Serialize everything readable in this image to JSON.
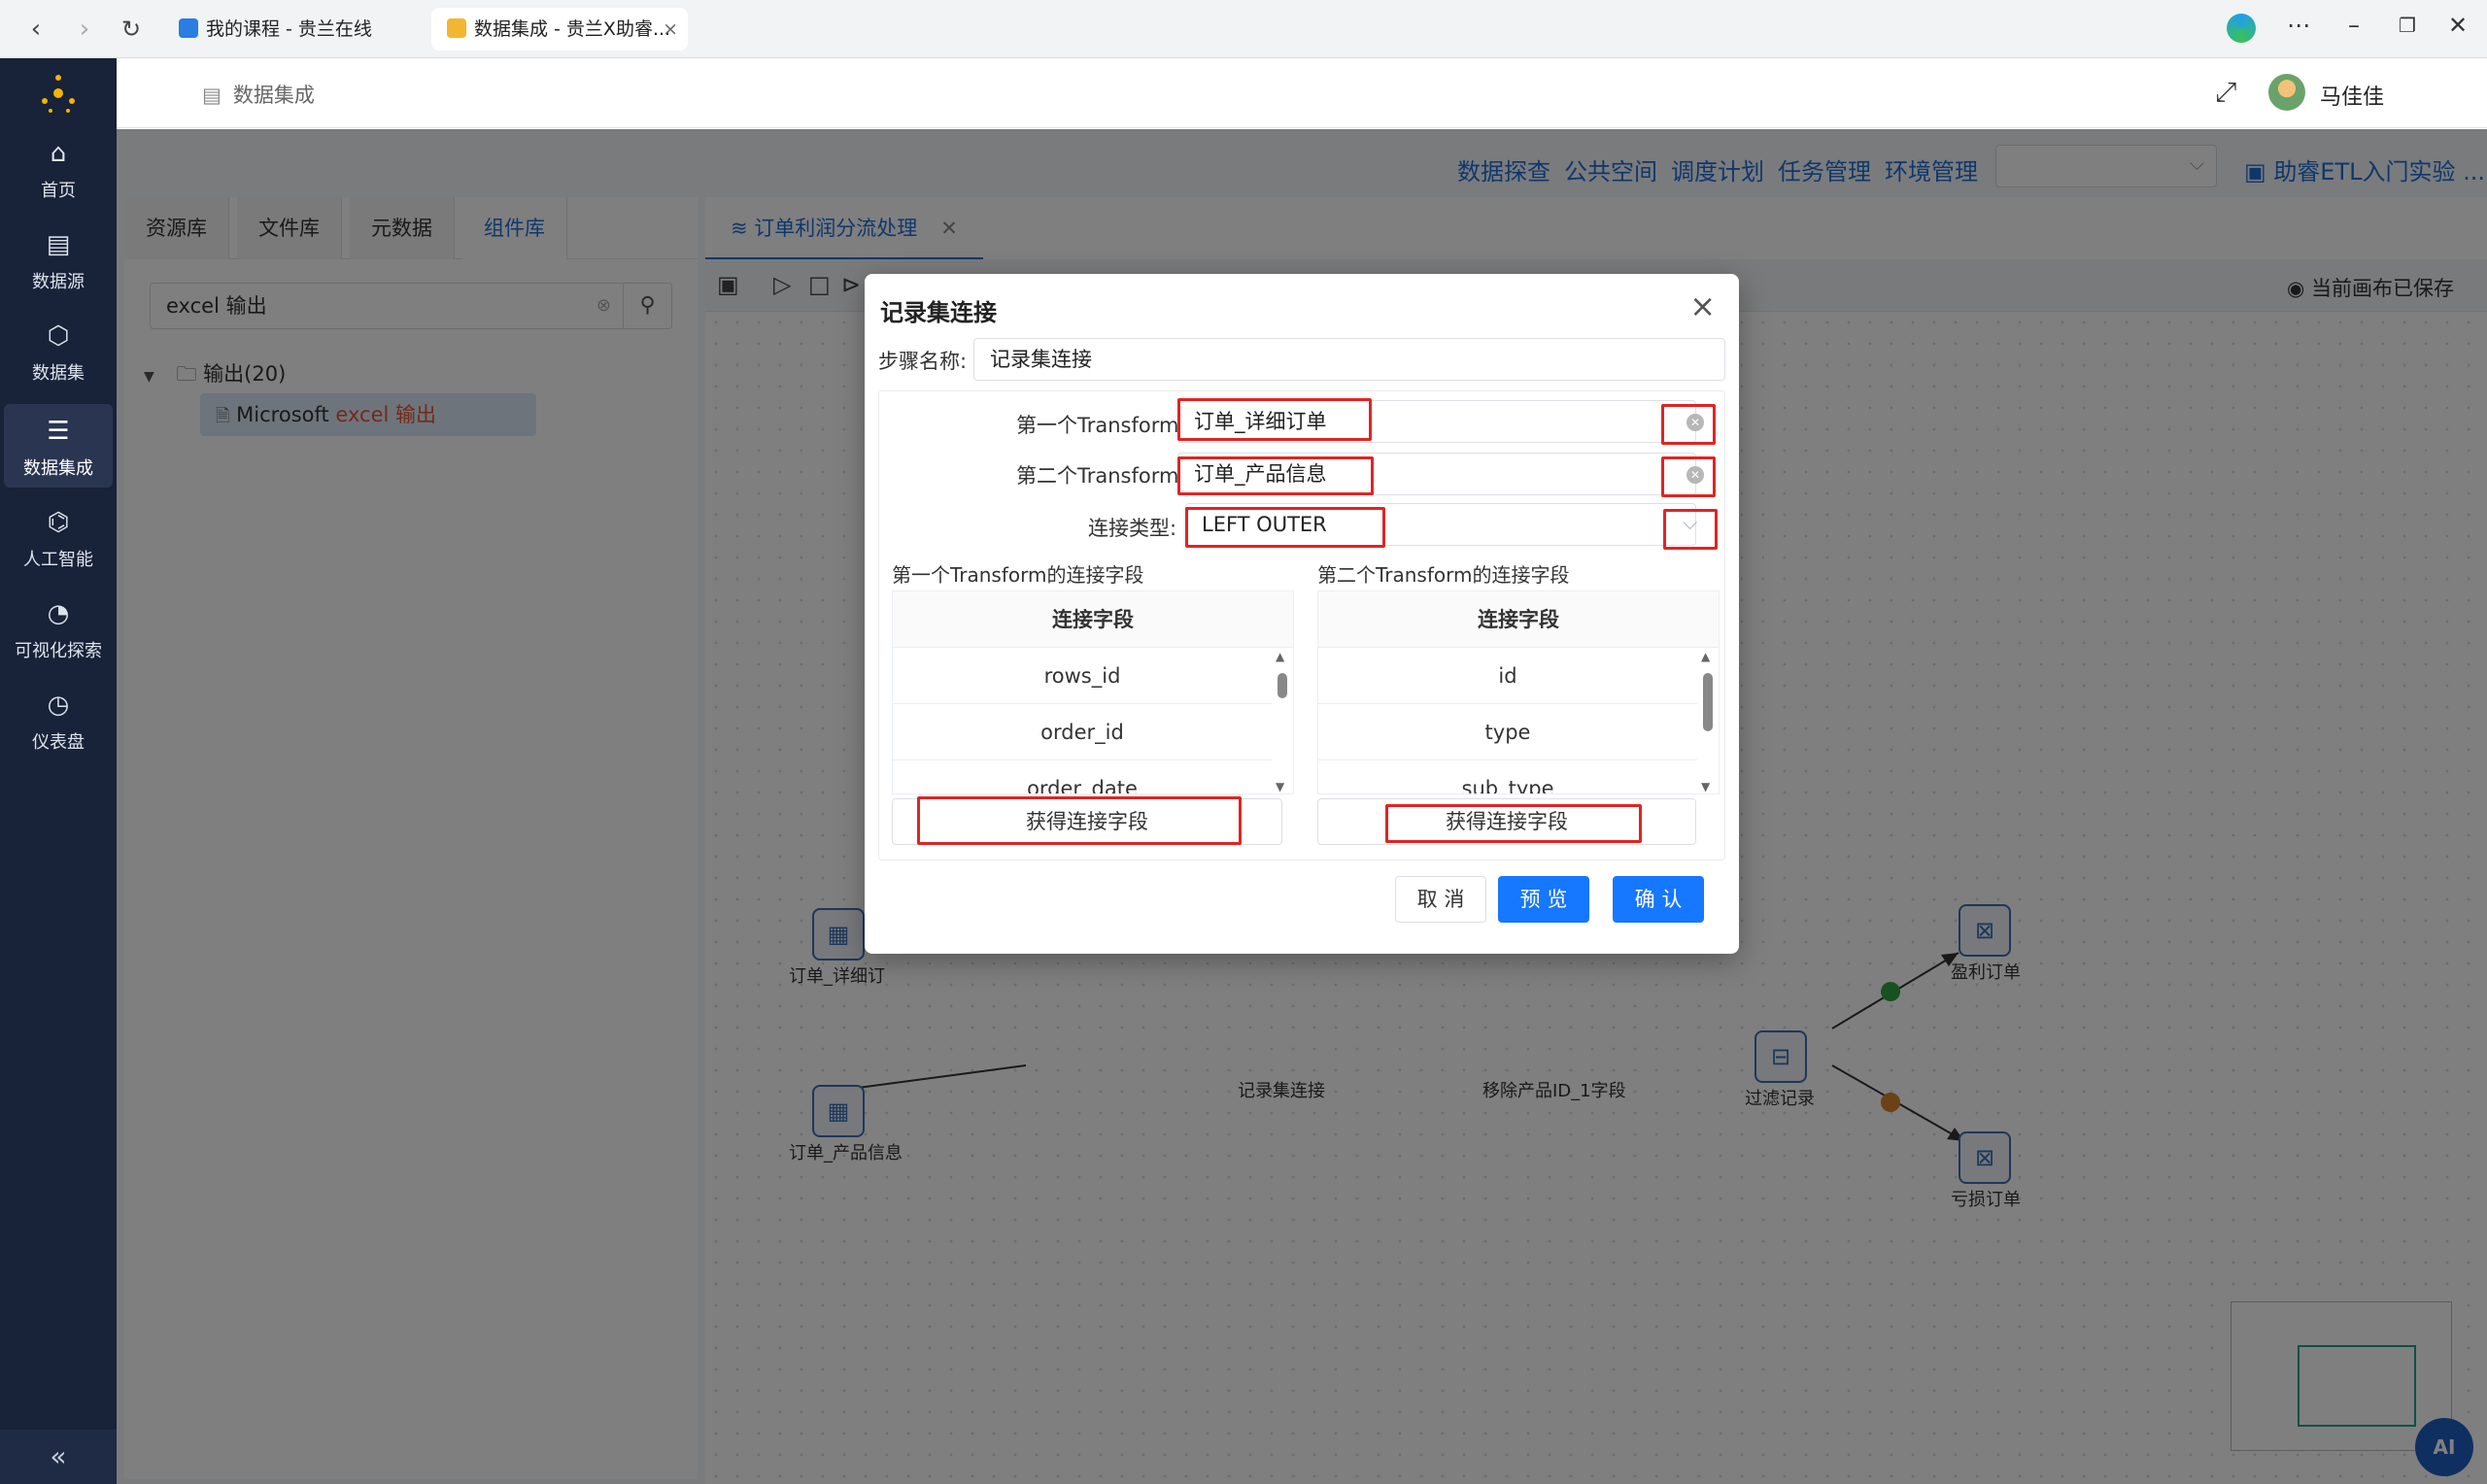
{
  "browser": {
    "tabs": [
      {
        "title": "我的课程 - 贵兰在线"
      },
      {
        "title": "数据集成 - 贵兰X助睿..."
      }
    ],
    "tab_close": "×"
  },
  "sidebar": {
    "items": [
      {
        "label": "首页",
        "icon": "home-icon"
      },
      {
        "label": "数据源",
        "icon": "datasource-icon"
      },
      {
        "label": "数据集",
        "icon": "dataset-icon"
      },
      {
        "label": "数据集成",
        "icon": "integration-icon"
      },
      {
        "label": "人工智能",
        "icon": "ai-icon"
      },
      {
        "label": "可视化探索",
        "icon": "chart-icon"
      },
      {
        "label": "仪表盘",
        "icon": "dashboard-icon"
      }
    ],
    "collapse": "«"
  },
  "header": {
    "breadcrumb": "数据集成",
    "user_name": "马佳佳"
  },
  "topnav": {
    "links": [
      "数据探查",
      "公共空间",
      "调度计划",
      "任务管理",
      "环境管理"
    ],
    "project": "助睿ETL入门实验 ..."
  },
  "left_panel": {
    "tabs": [
      "资源库",
      "文件库",
      "元数据",
      "组件库"
    ],
    "search_value": "excel 输出",
    "tree_node": "输出(20)",
    "tree_leaf_prefix": "Microsoft ",
    "tree_leaf_highlight": "excel 输出"
  },
  "canvas": {
    "tab_title": "订单利润分流处理",
    "saved_status": "当前画布已保存",
    "nodes": [
      {
        "label": "订单_详细订"
      },
      {
        "label": "订单_产品信息"
      },
      {
        "label": "记录集连接"
      },
      {
        "label": "移除产品ID_1字段"
      },
      {
        "label": "过滤记录"
      },
      {
        "label": "盈利订单"
      },
      {
        "label": "亏损订单"
      }
    ],
    "ai_label": "AI"
  },
  "dialog": {
    "title": "记录集连接",
    "step_name_label": "步骤名称:",
    "step_name_value": "记录集连接",
    "first_transform_label": "第一个Transform:",
    "first_transform_value": "订单_详细订单",
    "second_transform_label": "第二个Transform:",
    "second_transform_value": "订单_产品信息",
    "join_type_label": "连接类型:",
    "join_type_value": "LEFT OUTER",
    "left_section_title": "第一个Transform的连接字段",
    "right_section_title": "第二个Transform的连接字段",
    "left_table": {
      "header": "连接字段",
      "rows": [
        "rows_id",
        "order_id",
        "order_date"
      ]
    },
    "right_table": {
      "header": "连接字段",
      "rows": [
        "id",
        "type",
        "sub_type"
      ]
    },
    "get_fields_button": "获得连接字段",
    "cancel_button": "取 消",
    "preview_button": "预 览",
    "ok_button": "确 认"
  }
}
